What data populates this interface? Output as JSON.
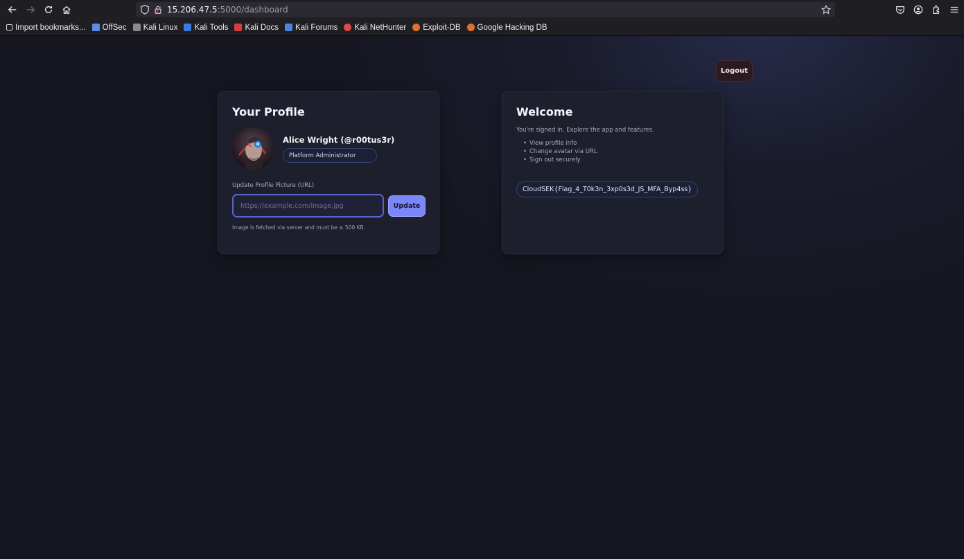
{
  "browser": {
    "url_host": "15.206.47.5",
    "url_rest": ":5000/dashboard",
    "bookmarks": [
      {
        "label": "Import bookmarks...",
        "icon": "import-icon",
        "color": "#d9d9de"
      },
      {
        "label": "OffSec",
        "icon": "offsec-icon",
        "color": "#5a8be8"
      },
      {
        "label": "Kali Linux",
        "icon": "kali-icon",
        "color": "#c7c7cf"
      },
      {
        "label": "Kali Tools",
        "icon": "kali-tools-icon",
        "color": "#3a7be0"
      },
      {
        "label": "Kali Docs",
        "icon": "kali-docs-icon",
        "color": "#d83a3a"
      },
      {
        "label": "Kali Forums",
        "icon": "kali-forums-icon",
        "color": "#4a86e0"
      },
      {
        "label": "Kali NetHunter",
        "icon": "nethunter-icon",
        "color": "#e04848"
      },
      {
        "label": "Exploit-DB",
        "icon": "exploit-db-icon",
        "color": "#e0702a"
      },
      {
        "label": "Google Hacking DB",
        "icon": "ghdb-icon",
        "color": "#e0702a"
      }
    ]
  },
  "header": {
    "logout_label": "Logout"
  },
  "profile": {
    "title": "Your Profile",
    "name": "Alice Wright (@r00tus3r)",
    "role": "Platform Administrator",
    "field_label": "Update Profile Picture (URL)",
    "url_placeholder": "https://example.com/image.jpg",
    "url_value": "",
    "update_label": "Update",
    "hint": "Image is fetched via server and must be ≤ 500 KB."
  },
  "welcome": {
    "title": "Welcome",
    "intro": "You're signed in. Explore the app and features.",
    "features": [
      "View profile info",
      "Change avatar via URL",
      "Sign out securely"
    ],
    "flag": "CloudSEK{Flag_4_T0k3n_3xp0s3d_JS_MFA_Byp4ss}"
  },
  "colors": {
    "accent": "#7b86f7",
    "background": "#14151f",
    "card": "#1d1f2c"
  }
}
